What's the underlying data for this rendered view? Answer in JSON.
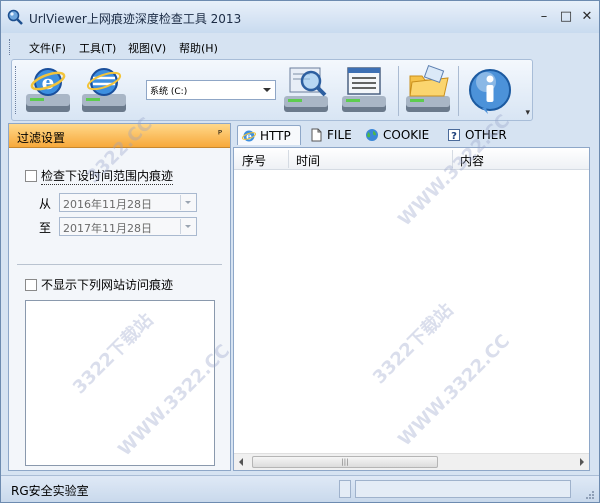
{
  "window": {
    "title": "UrlViewer上网痕迹深度检查工具 2013",
    "controls": {
      "minimize": "–",
      "maximize": "□",
      "close": "✕"
    }
  },
  "menu": {
    "items": [
      {
        "label": "文件(F)"
      },
      {
        "label": "工具(T)"
      },
      {
        "label": "视图(V)"
      },
      {
        "label": "帮助(H)"
      }
    ]
  },
  "toolbar": {
    "drive_select": {
      "value": "系统 (C:)"
    },
    "more_glyph": "▾"
  },
  "filter_panel": {
    "title": "过滤设置",
    "pin_glyph": "ᴾ",
    "time_filter": {
      "label": "检查下设时间范围内痕迹",
      "checked": false,
      "from_label": "从",
      "from_value": "2016年11月28日",
      "to_label": "至",
      "to_value": "2017年11月28日"
    },
    "site_filter": {
      "label": "不显示下列网站访问痕迹",
      "checked": false
    }
  },
  "tabs": [
    {
      "label": "HTTP",
      "icon": "ie-icon",
      "active": true
    },
    {
      "label": "FILE",
      "icon": "file-icon",
      "active": false
    },
    {
      "label": "COOKIE",
      "icon": "globe-icon",
      "active": false
    },
    {
      "label": "OTHER",
      "icon": "help-icon",
      "active": false
    }
  ],
  "list": {
    "columns": [
      "序号",
      "时间",
      "内容"
    ],
    "rows": [],
    "scroll_thumb_glyph": "|||"
  },
  "status": {
    "text": "RG安全实验室"
  },
  "watermarks": [
    "3322.CC",
    "3322下载站",
    "WWW.3322.CC"
  ],
  "colors": {
    "panel_header": "#f7a93b",
    "window_bg": "#d6e3f2"
  }
}
